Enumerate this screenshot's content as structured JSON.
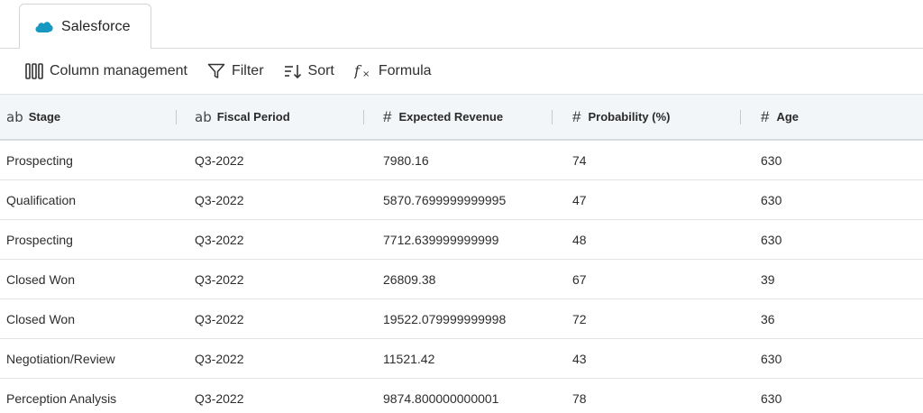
{
  "tab": {
    "label": "Salesforce",
    "icon": "salesforce-cloud-icon",
    "icon_color": "#1798c1"
  },
  "toolbar": {
    "column_management": "Column management",
    "filter": "Filter",
    "sort": "Sort",
    "formula": "Formula"
  },
  "table": {
    "columns": [
      {
        "type": "ab",
        "label": "Stage"
      },
      {
        "type": "ab",
        "label": "Fiscal Period"
      },
      {
        "type": "#",
        "label": "Expected Revenue"
      },
      {
        "type": "#",
        "label": "Probability (%)"
      },
      {
        "type": "#",
        "label": "Age"
      }
    ],
    "rows": [
      [
        "Prospecting",
        "Q3-2022",
        "7980.16",
        "74",
        "630"
      ],
      [
        "Qualification",
        "Q3-2022",
        "5870.7699999999995",
        "47",
        "630"
      ],
      [
        "Prospecting",
        "Q3-2022",
        "7712.639999999999",
        "48",
        "630"
      ],
      [
        "Closed Won",
        "Q3-2022",
        "26809.38",
        "67",
        "39"
      ],
      [
        "Closed Won",
        "Q3-2022",
        "19522.079999999998",
        "72",
        "36"
      ],
      [
        "Negotiation/Review",
        "Q3-2022",
        "11521.42",
        "43",
        "630"
      ],
      [
        "Perception Analysis",
        "Q3-2022",
        "9874.800000000001",
        "78",
        "630"
      ]
    ]
  },
  "colors": {
    "header_bg": "#f3f6f8",
    "accent_cloud": "#1798c1"
  }
}
